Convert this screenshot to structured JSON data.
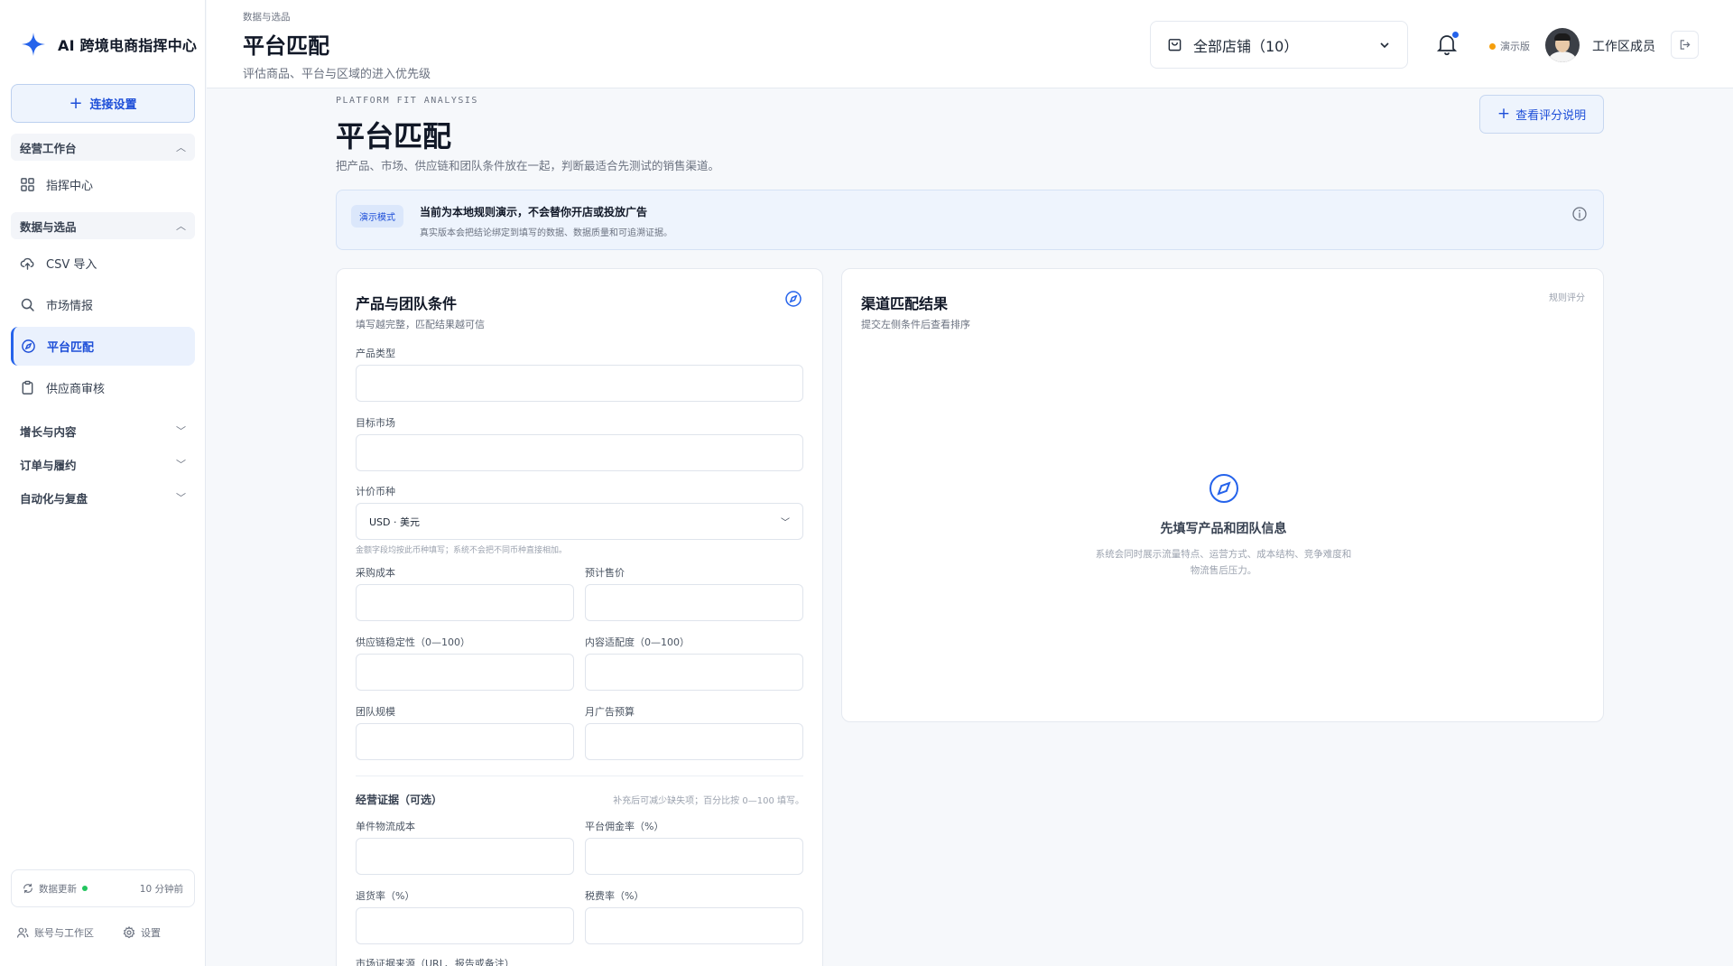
{
  "brand": {
    "name": "AI 跨境电商指挥中心",
    "icon": "sparkle-icon"
  },
  "sidebar": {
    "connect_label": "连接设置",
    "groups": [
      {
        "label": "经营工作台"
      },
      {
        "label": "数据与选品"
      },
      {
        "label": "增长与内容"
      },
      {
        "label": "订单与履约"
      },
      {
        "label": "自动化与复盘"
      }
    ],
    "items": [
      {
        "label": "指挥中心",
        "icon": "grid-icon"
      },
      {
        "label": "CSV 导入",
        "icon": "upload-cloud-icon"
      },
      {
        "label": "市场情报",
        "icon": "search-icon"
      },
      {
        "label": "平台匹配",
        "icon": "compass-icon"
      },
      {
        "label": "供应商审核",
        "icon": "clipboard-icon"
      }
    ],
    "sync_label": "数据更新",
    "sync_time": "10 分钟前",
    "account_label": "账号与工作区",
    "settings_label": "设置"
  },
  "header": {
    "breadcrumb": "数据与选品",
    "title": "平台匹配",
    "subtitle": "评估商品、平台与区域的进入优先级",
    "store_select": "全部店铺（10）",
    "demo_label": "演示版",
    "member_name": "工作区成员"
  },
  "page": {
    "kicker": "PLATFORM FIT ANALYSIS",
    "title": "平台匹配",
    "subtitle": "把产品、市场、供应链和团队条件放在一起，判断最适合先测试的销售渠道。",
    "score_button": "查看评分说明"
  },
  "notice": {
    "tag": "演示模式",
    "title": "当前为本地规则演示，不会替你开店或投放广告",
    "detail": "真实版本会把结论绑定到填写的数据、数据质量和可追溯证据。"
  },
  "form": {
    "title": "产品与团队条件",
    "subtitle": "填写越完整，匹配结果越可信",
    "product_type_label": "产品类型",
    "target_market_label": "目标市场",
    "currency_label": "计价币种",
    "currency_value": "USD · 美元",
    "currency_hint": "金额字段均按此币种填写；系统不会把不同币种直接相加。",
    "purchase_cost_label": "采购成本",
    "expected_price_label": "预计售价",
    "supply_stability_label": "供应链稳定性（0—100）",
    "content_fit_label": "内容适配度（0—100）",
    "team_size_label": "团队规模",
    "monthly_ad_budget_label": "月广告预算",
    "evidence_title": "经营证据（可选）",
    "evidence_hint": "补充后可减少缺失项；百分比按 0—100 填写。",
    "unit_logistics_label": "单件物流成本",
    "platform_commission_label": "平台佣金率（%）",
    "return_rate_label": "退货率（%）",
    "tax_rate_label": "税费率（%）",
    "evidence_source_label": "市场证据来源（URL、报告或备注）"
  },
  "results": {
    "title": "渠道匹配结果",
    "subtitle": "提交左侧条件后查看排序",
    "rule_tag": "规则评分",
    "empty_title": "先填写产品和团队信息",
    "empty_detail": "系统会同时展示流量特点、运营方式、成本结构、竞争难度和物流售后压力。"
  },
  "colors": {
    "accent": "#2563eb",
    "accent_bg": "#eef4fd",
    "status_ok": "#22c55e",
    "demo_dot": "#f59e0b"
  }
}
